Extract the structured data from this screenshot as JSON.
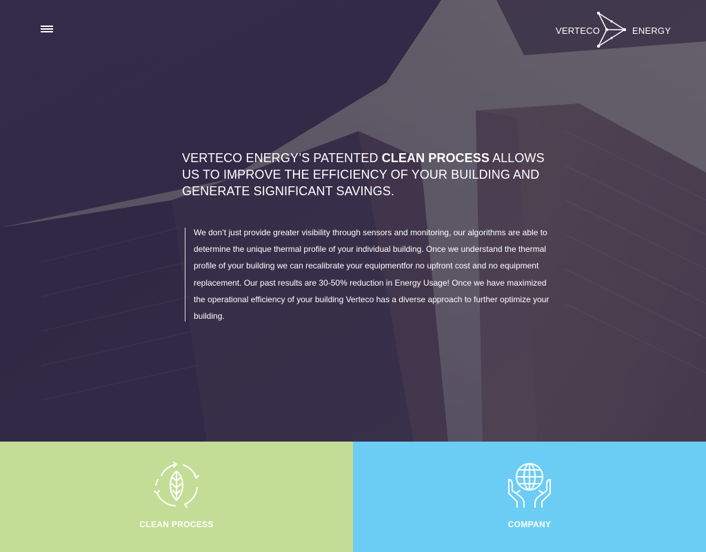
{
  "colors": {
    "clean_tile": "#c3dd97",
    "company_tile": "#6bcdf4",
    "text": "#ffffff"
  },
  "nav": {
    "menu_icon": "hamburger-icon"
  },
  "logo": {
    "left_word": "VERTECO",
    "right_word": "ENERGY",
    "mark_icon": "arrow-constellation-icon"
  },
  "hero": {
    "headline_pre": "VERTECO ENERGY’S PATENTED ",
    "headline_bold": "CLEAN PROCESS",
    "headline_post": " ALLOWS US TO IMPROVE THE EFFICIENCY OF YOUR BUILDING AND GENERATE SIGNIFICANT SAVINGS.",
    "body": "We don’t just provide greater visibility through sensors and monitoring, our algorithms are able to determine the unique thermal profile of your individual building. Once we understand the thermal profile of your building we can recalibrate your equipmentfor no upfront cost and no equipment replacement.  Our past results are 30-50% reduction in Energy Usage! Once we have maximized the operational efficiency of your building Verteco has a diverse approach to further optimize your building."
  },
  "tiles": [
    {
      "label": "CLEAN PROCESS",
      "icon": "leaf-cycle-icon"
    },
    {
      "label": "COMPANY",
      "icon": "globe-hands-icon"
    }
  ]
}
